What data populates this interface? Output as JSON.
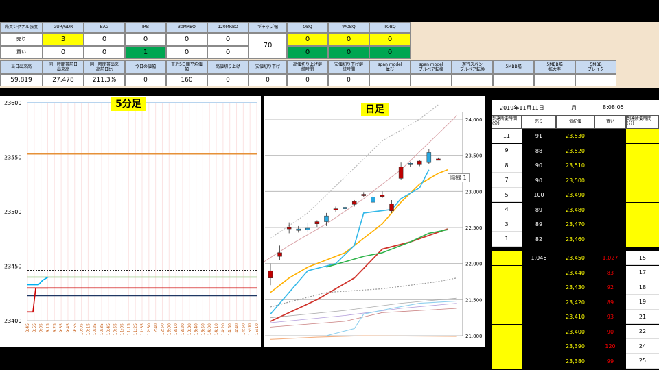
{
  "top_table": {
    "row1_headers": [
      "売買シグナル強度",
      "GUR/GDR",
      "BAG",
      "IRB",
      "30MRBO",
      "120MRBO",
      "ギャップ幅",
      "OBQ",
      "WOBQ",
      "TOBQ"
    ],
    "sell_label": "売り",
    "buy_label": "買い",
    "sell_values": [
      "3",
      "0",
      "0",
      "0",
      "0"
    ],
    "buy_values": [
      "0",
      "0",
      "1",
      "0",
      "0"
    ],
    "gap_value": "70",
    "sell_q": [
      "0",
      "0",
      "0"
    ],
    "buy_q": [
      "0",
      "0",
      "0"
    ],
    "row3_headers": [
      "当日出来高",
      "同一時間帯前日\n出来高",
      "同一時間帯出来\n高前日比",
      "今日の値幅",
      "直近5日間平均値\n幅",
      "高値切り上げ",
      "安値切り下げ",
      "高値切り上げ継\n続時間",
      "安値切り下げ継\n続時間",
      "span model\n並び",
      "span model\nブルベア転換",
      "遅行スパン\nブルベア転換",
      "5MBB幅",
      "5MBB幅\n拡大率",
      "5MBB\nブレイク"
    ],
    "row4_values": [
      "59,819",
      "27,478",
      "211.3%",
      "0",
      "160",
      "0",
      "0",
      "0",
      "0",
      "",
      "",
      "",
      "",
      "",
      ""
    ]
  },
  "chart5": {
    "title": "5分足",
    "y_ticks": [
      "23600",
      "23550",
      "23500",
      "23450",
      "23400"
    ],
    "x_ticks": [
      "8:45",
      "8:55",
      "9:05",
      "9:15",
      "9:25",
      "9:35",
      "9:45",
      "9:55",
      "10:05",
      "10:15",
      "10:25",
      "10:35",
      "10:45",
      "10:55",
      "11:05",
      "11:15",
      "11:25",
      "11:35",
      "12:30",
      "12:40",
      "12:50",
      "13:00",
      "13:10",
      "13:20",
      "13:30",
      "13:40",
      "13:50",
      "14:00",
      "14:10",
      "14:20",
      "14:30",
      "14:40",
      "14:50",
      "15:00",
      "15:10"
    ],
    "lines": [
      {
        "price": 23600,
        "color": "#9fc5e8"
      },
      {
        "price": 23553,
        "color": "#e69138"
      },
      {
        "price": 23446,
        "color": "#000000",
        "dash": true
      },
      {
        "price": 23440,
        "color": "#93c47d"
      },
      {
        "price": 23430,
        "color": "#cc0000"
      },
      {
        "price": 23423,
        "color": "#1f3864"
      }
    ]
  },
  "chartD": {
    "title": "日足",
    "y_ticks": [
      "24,000",
      "23,500",
      "23,000",
      "22,500",
      "22,000",
      "21,500",
      "21,000"
    ],
    "y_min": 21000,
    "y_max": 24000,
    "tooltip": "陰線 1",
    "candles": [
      {
        "o": 21900,
        "h": 22000,
        "l": 21700,
        "c": 21800,
        "up": false
      },
      {
        "o": 22150,
        "h": 22250,
        "l": 22050,
        "c": 22100,
        "up": false
      },
      {
        "o": 22480,
        "h": 22570,
        "l": 22420,
        "c": 22500,
        "up": false
      },
      {
        "o": 22480,
        "h": 22520,
        "l": 22430,
        "c": 22460,
        "up": true
      },
      {
        "o": 22490,
        "h": 22560,
        "l": 22440,
        "c": 22470,
        "up": true
      },
      {
        "o": 22550,
        "h": 22600,
        "l": 22510,
        "c": 22580,
        "up": false
      },
      {
        "o": 22580,
        "h": 22700,
        "l": 22520,
        "c": 22660,
        "up": true
      },
      {
        "o": 22750,
        "h": 22790,
        "l": 22720,
        "c": 22760,
        "up": false
      },
      {
        "o": 22760,
        "h": 22800,
        "l": 22720,
        "c": 22780,
        "up": true
      },
      {
        "o": 22820,
        "h": 22880,
        "l": 22790,
        "c": 22860,
        "up": false
      },
      {
        "o": 22950,
        "h": 22990,
        "l": 22920,
        "c": 22960,
        "up": false
      },
      {
        "o": 22850,
        "h": 22960,
        "l": 22830,
        "c": 22920,
        "up": true
      },
      {
        "o": 22950,
        "h": 23000,
        "l": 22910,
        "c": 22930,
        "up": false
      },
      {
        "o": 22830,
        "h": 22880,
        "l": 22700,
        "c": 22730,
        "up": false
      },
      {
        "o": 23340,
        "h": 23400,
        "l": 23160,
        "c": 23180,
        "up": false
      },
      {
        "o": 23370,
        "h": 23400,
        "l": 23340,
        "c": 23390,
        "up": true
      },
      {
        "o": 23420,
        "h": 23430,
        "l": 23350,
        "c": 23370,
        "up": false
      },
      {
        "o": 23400,
        "h": 23590,
        "l": 23380,
        "c": 23540,
        "up": true
      },
      {
        "o": 23450,
        "h": 23470,
        "l": 23440,
        "c": 23450,
        "up": false
      }
    ]
  },
  "board": {
    "date": "2019年11月11日",
    "weekday": "月",
    "time": "8:08:05",
    "headers": [
      "到達所要時間(分)",
      "売り",
      "気配値",
      "買い",
      "到達所要時間(分)"
    ],
    "sell_rows": [
      {
        "t": "11",
        "qty": "91",
        "price": "23,530"
      },
      {
        "t": "9",
        "qty": "88",
        "price": "23,520"
      },
      {
        "t": "8",
        "qty": "90",
        "price": "23,510"
      },
      {
        "t": "7",
        "qty": "90",
        "price": "23,500"
      },
      {
        "t": "5",
        "qty": "100",
        "price": "23,490"
      },
      {
        "t": "4",
        "qty": "89",
        "price": "23,480"
      },
      {
        "t": "3",
        "qty": "89",
        "price": "23,470"
      },
      {
        "t": "1",
        "qty": "82",
        "price": "23,460"
      }
    ],
    "buy_rows": [
      {
        "sell": "1,046",
        "price": "23,450",
        "buy": "1,027",
        "t": "15"
      },
      {
        "sell": "",
        "price": "23,440",
        "buy": "83",
        "t": "17"
      },
      {
        "sell": "",
        "price": "23,430",
        "buy": "92",
        "t": "18"
      },
      {
        "sell": "",
        "price": "23,420",
        "buy": "89",
        "t": "19"
      },
      {
        "sell": "",
        "price": "23,410",
        "buy": "93",
        "t": "21"
      },
      {
        "sell": "",
        "price": "23,400",
        "buy": "90",
        "t": "22"
      },
      {
        "sell": "",
        "price": "23,390",
        "buy": "120",
        "t": "24"
      },
      {
        "sell": "",
        "price": "23,380",
        "buy": "99",
        "t": "25"
      }
    ]
  },
  "colors": {
    "sell_price": "#ffff00",
    "buy_qty": "#ff0000",
    "cell_yellow": "#ffff00",
    "cell_green": "#00a651"
  }
}
